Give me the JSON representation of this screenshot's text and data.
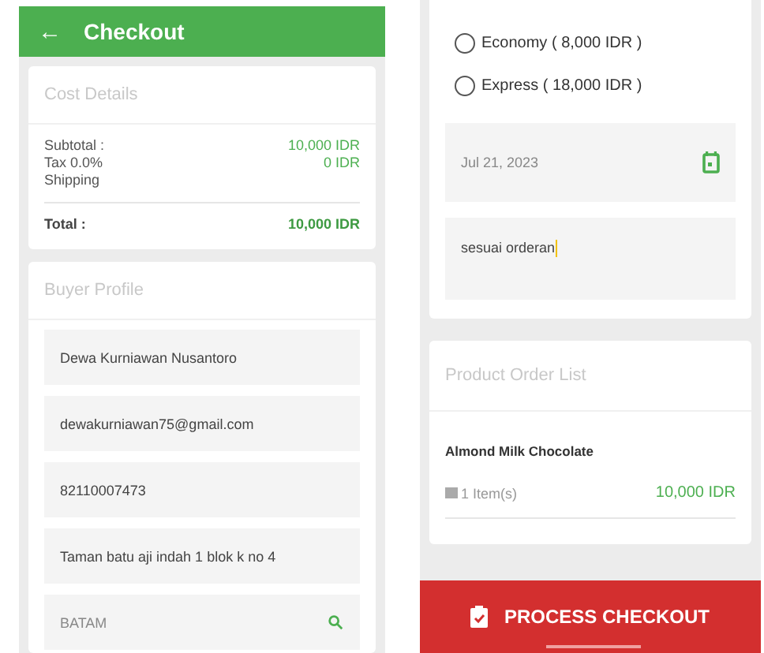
{
  "left_screen": {
    "header": {
      "back": "←",
      "title": "Checkout"
    },
    "cost_details": {
      "title": "Cost Details",
      "rows": [
        {
          "label": "Subtotal :",
          "value": "10,000 IDR"
        },
        {
          "label": "Tax 0.0%",
          "value": "0 IDR"
        },
        {
          "label": "Shipping"
        }
      ],
      "total": {
        "label": "Total :",
        "value": "10,000 IDR"
      }
    },
    "buyer_profile": {
      "title": "Buyer Profile",
      "fields": [
        {
          "kind": "text",
          "value": "Dewa Kurniawan Nusantoro"
        },
        {
          "kind": "text",
          "value": "dewakurniawan75@gmail.com"
        },
        {
          "kind": "text",
          "value": "82110007473"
        },
        {
          "kind": "text",
          "value": "Taman batu aji indah 1 blok k no 4"
        },
        {
          "kind": "search",
          "value": "BATAM"
        }
      ]
    }
  },
  "right_screen": {
    "shipping_options": [
      {
        "label": "Economy ( 8,000 IDR )",
        "selected": false
      },
      {
        "label": "Express ( 18,000 IDR )",
        "selected": false
      }
    ],
    "date_field": {
      "value": "Jul 21, 2023"
    },
    "note_field": {
      "value": "sesuai orderan"
    },
    "product_order_list": {
      "title": "Product Order List",
      "items": [
        {
          "name": "Almond Milk Chocolate",
          "quantity": "1 Item(s)",
          "price": "10,000 IDR"
        }
      ]
    },
    "process_button": {
      "label": "PROCESS CHECKOUT"
    }
  }
}
